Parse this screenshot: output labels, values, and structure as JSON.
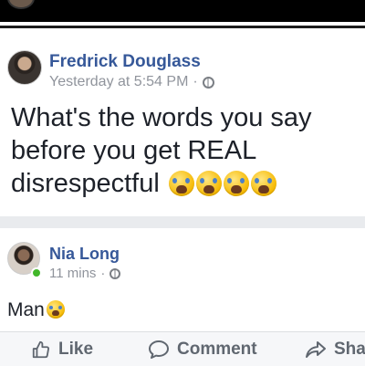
{
  "post": {
    "author": "Fredrick Douglass",
    "timestamp": "Yesterday at 5:54 PM",
    "separator": "·",
    "privacy_icon": "globe-icon",
    "text_line1": "What's the words you say",
    "text_line2": "before you get REAL",
    "text_line3": "disrespectful",
    "emoji_icon": "loudly-crying-face-emoji",
    "emoji_count": 4
  },
  "comment": {
    "author": "Nia Long",
    "timestamp": "11 mins",
    "separator": "·",
    "privacy_icon": "globe-icon",
    "text": "Man",
    "emoji_icon": "loudly-crying-face-emoji",
    "online_status_color": "#42b72a"
  },
  "actions": {
    "like": "Like",
    "comment": "Comment",
    "share": "Sha"
  },
  "colors": {
    "name": "#365899",
    "meta": "#90949c",
    "text": "#1d2129",
    "background": "#e9ebee"
  }
}
